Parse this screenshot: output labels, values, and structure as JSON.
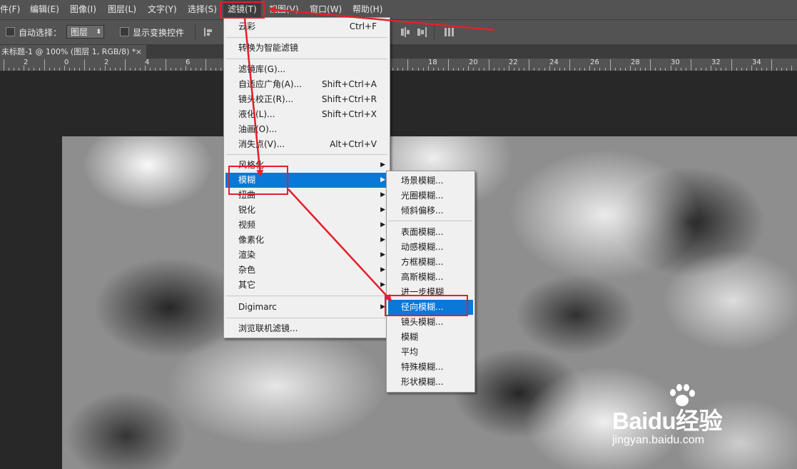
{
  "menubar": {
    "items": [
      "件(F)",
      "编辑(E)",
      "图像(I)",
      "图层(L)",
      "文字(Y)",
      "选择(S)",
      "滤镜(T)",
      "视图(V)",
      "窗口(W)",
      "帮助(H)"
    ]
  },
  "options": {
    "auto_select": "自动选择：",
    "target": "图层",
    "show_transform": "显示变换控件"
  },
  "document_tab": {
    "title": "未标题-1 @ 100% (图层 1, RGB/8) *",
    "close": "×"
  },
  "ruler": {
    "labels": [
      "2",
      "0",
      "2",
      "4",
      "6",
      "8",
      "18",
      "20",
      "22",
      "24",
      "26",
      "28",
      "30",
      "32",
      "34"
    ]
  },
  "filter_menu": {
    "items": [
      {
        "label": "云彩",
        "shortcut": "Ctrl+F"
      },
      {
        "label": "转换为智能滤镜"
      },
      {
        "label": "滤镜库(G)..."
      },
      {
        "label": "自适应广角(A)...",
        "shortcut": "Shift+Ctrl+A"
      },
      {
        "label": "镜头校正(R)...",
        "shortcut": "Shift+Ctrl+R"
      },
      {
        "label": "液化(L)...",
        "shortcut": "Shift+Ctrl+X"
      },
      {
        "label": "油画(O)..."
      },
      {
        "label": "消失点(V)...",
        "shortcut": "Alt+Ctrl+V"
      },
      {
        "label": "风格化"
      },
      {
        "label": "模糊"
      },
      {
        "label": "扭曲"
      },
      {
        "label": "锐化"
      },
      {
        "label": "视频"
      },
      {
        "label": "像素化"
      },
      {
        "label": "渲染"
      },
      {
        "label": "杂色"
      },
      {
        "label": "其它"
      },
      {
        "label": "Digimarc"
      },
      {
        "label": "浏览联机滤镜..."
      }
    ]
  },
  "blur_submenu": {
    "items": [
      "场景模糊...",
      "光圈模糊...",
      "倾斜偏移...",
      "表面模糊...",
      "动感模糊...",
      "方框模糊...",
      "高斯模糊...",
      "进一步模糊",
      "径向模糊...",
      "镜头模糊...",
      "模糊",
      "平均",
      "特殊模糊...",
      "形状模糊..."
    ]
  },
  "watermark": {
    "brand": "Baidu经验",
    "url": "jingyan.baidu.com"
  },
  "colors": {
    "highlight": "#0a78d7",
    "annotation": "#e41f2b"
  },
  "icons": [
    "submenu-arrow-icon",
    "close-icon",
    "dropdown-arrow-icon",
    "align-icon",
    "baidu-paw-icon"
  ]
}
